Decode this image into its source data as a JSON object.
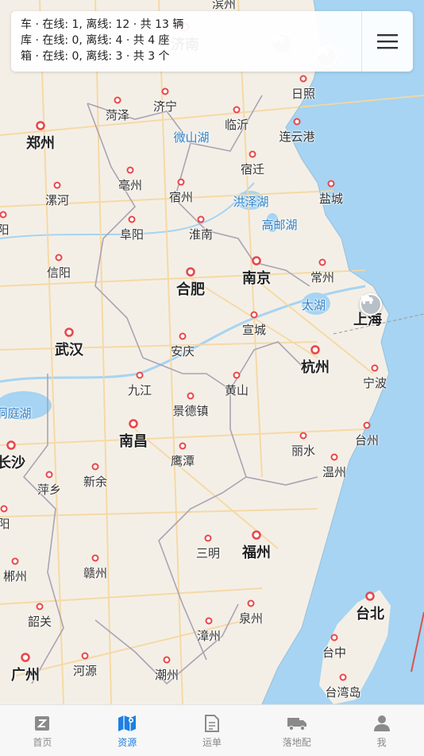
{
  "status_panel": {
    "vehicles": "车 · 在线: 1, 离线: 12 · 共 13 辆",
    "warehouses": "库 · 在线: 0, 离线: 4 · 共 4 座",
    "containers": "箱 · 在线: 0, 离线: 3 · 共 3 个"
  },
  "map": {
    "cities": {
      "binzhou": "滨州",
      "jinan": "济南",
      "rizhao": "日照",
      "heze": "菏泽",
      "jining": "济宁",
      "linyi": "临沂",
      "zhengzhou": "郑州",
      "lianyungang": "连云港",
      "weishanhu": "微山湖",
      "suqian": "宿迁",
      "bozhou": "亳州",
      "luohe": "漯河",
      "suzhou_ah": "宿州",
      "hongzehu": "洪泽湖",
      "yancheng": "盐城",
      "gaoyouhu": "高邮湖",
      "fuyang": "阜阳",
      "huainan": "淮南",
      "xinyang": "信阳",
      "hefei": "合肥",
      "nanjing": "南京",
      "changzhou": "常州",
      "taihu": "太湖",
      "shanghai": "上海",
      "wuhan": "武汉",
      "xuancheng": "宣城",
      "anqing": "安庆",
      "hangzhou": "杭州",
      "jiujiang": "九江",
      "huangshan": "黄山",
      "ningbo": "宁波",
      "dongtinghu": "洞庭湖",
      "jingdezhen": "景德镇",
      "nanchang": "南昌",
      "changsha": "长沙",
      "lishui": "丽水",
      "taizhou_zj": "台州",
      "yingtan": "鹰潭",
      "pingxiang": "萍乡",
      "xinyu": "新余",
      "wenzhou": "温州",
      "sanming": "三明",
      "fuzhou": "福州",
      "chenzhou": "郴州",
      "ganzhou": "赣州",
      "taibei": "台北",
      "shaoguan": "韶关",
      "quanzhou": "泉州",
      "zhangzhou": "漳州",
      "taizhong": "台中",
      "guangzhou": "广州",
      "heyuan": "河源",
      "chaozhou": "潮州",
      "gaoxiong": "台湾岛",
      "yang": "阳",
      "qing": "阳",
      "dao": "岛"
    },
    "marker_icons": [
      "truck-icon"
    ]
  },
  "tabbar": {
    "items": [
      {
        "label": "首页",
        "icon": "home-icon",
        "active": false
      },
      {
        "label": "资源",
        "icon": "map-resource-icon",
        "active": true
      },
      {
        "label": "运单",
        "icon": "waybill-icon",
        "active": false
      },
      {
        "label": "落地配",
        "icon": "delivery-truck-icon",
        "active": false
      },
      {
        "label": "我",
        "icon": "profile-icon",
        "active": false
      }
    ]
  },
  "colors": {
    "land": "#f4efe6",
    "sea": "#a6d4f2",
    "lake": "#a6d4f2",
    "border": "#a9a3b5",
    "road": "#f6d7a0",
    "city_dot": "#e8464a",
    "tab_active": "#1f7fe0",
    "tab_inactive": "#8a8a8a"
  }
}
